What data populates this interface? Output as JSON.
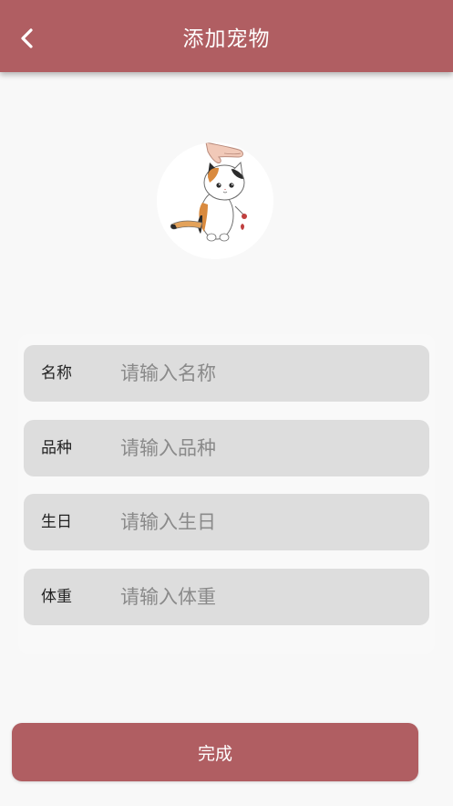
{
  "colors": {
    "primary": "#b05e62",
    "background": "#f8f8f8",
    "field_background": "#dddddd",
    "placeholder": "#8a8a8a",
    "label": "#222222"
  },
  "header": {
    "title": "添加宠物",
    "back_icon": "chevron-left-icon"
  },
  "avatar": {
    "icon": "cat-illustration-icon"
  },
  "form": {
    "fields": [
      {
        "label": "名称",
        "value": "",
        "placeholder": "请输入名称"
      },
      {
        "label": "品种",
        "value": "",
        "placeholder": "请输入品种"
      },
      {
        "label": "生日",
        "value": "",
        "placeholder": "请输入生日"
      },
      {
        "label": "体重",
        "value": "",
        "placeholder": "请输入体重"
      }
    ]
  },
  "submit": {
    "label": "完成"
  }
}
